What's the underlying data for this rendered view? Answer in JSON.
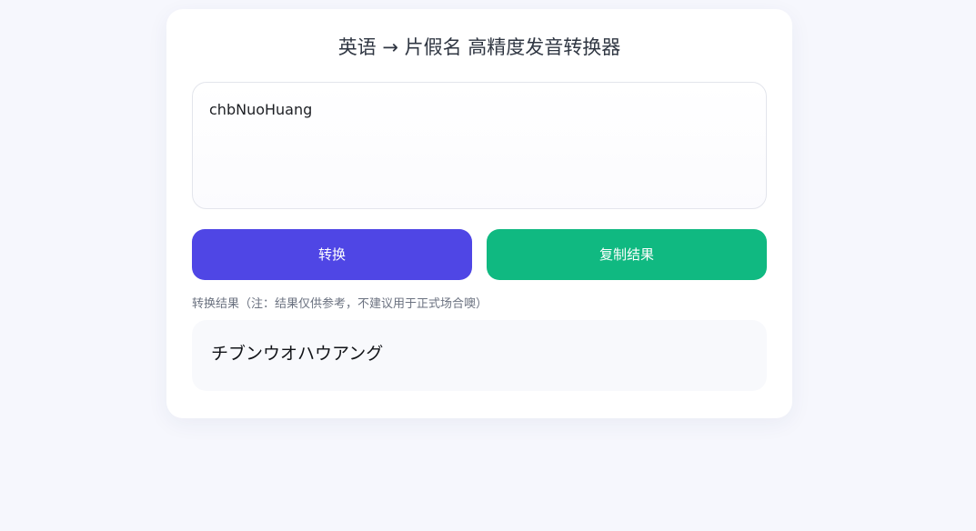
{
  "header": {
    "title": "英语 → 片假名 高精度发音转换器"
  },
  "input": {
    "value": "chbNuoHuang"
  },
  "actions": {
    "convert_label": "转换",
    "copy_label": "复制结果"
  },
  "result": {
    "note": "转换结果（注：结果仅供参考，不建议用于正式场合噢）",
    "value": "チブンウオハウアング"
  },
  "colors": {
    "convert_button": "#4f46e5",
    "copy_button": "#10b981"
  }
}
